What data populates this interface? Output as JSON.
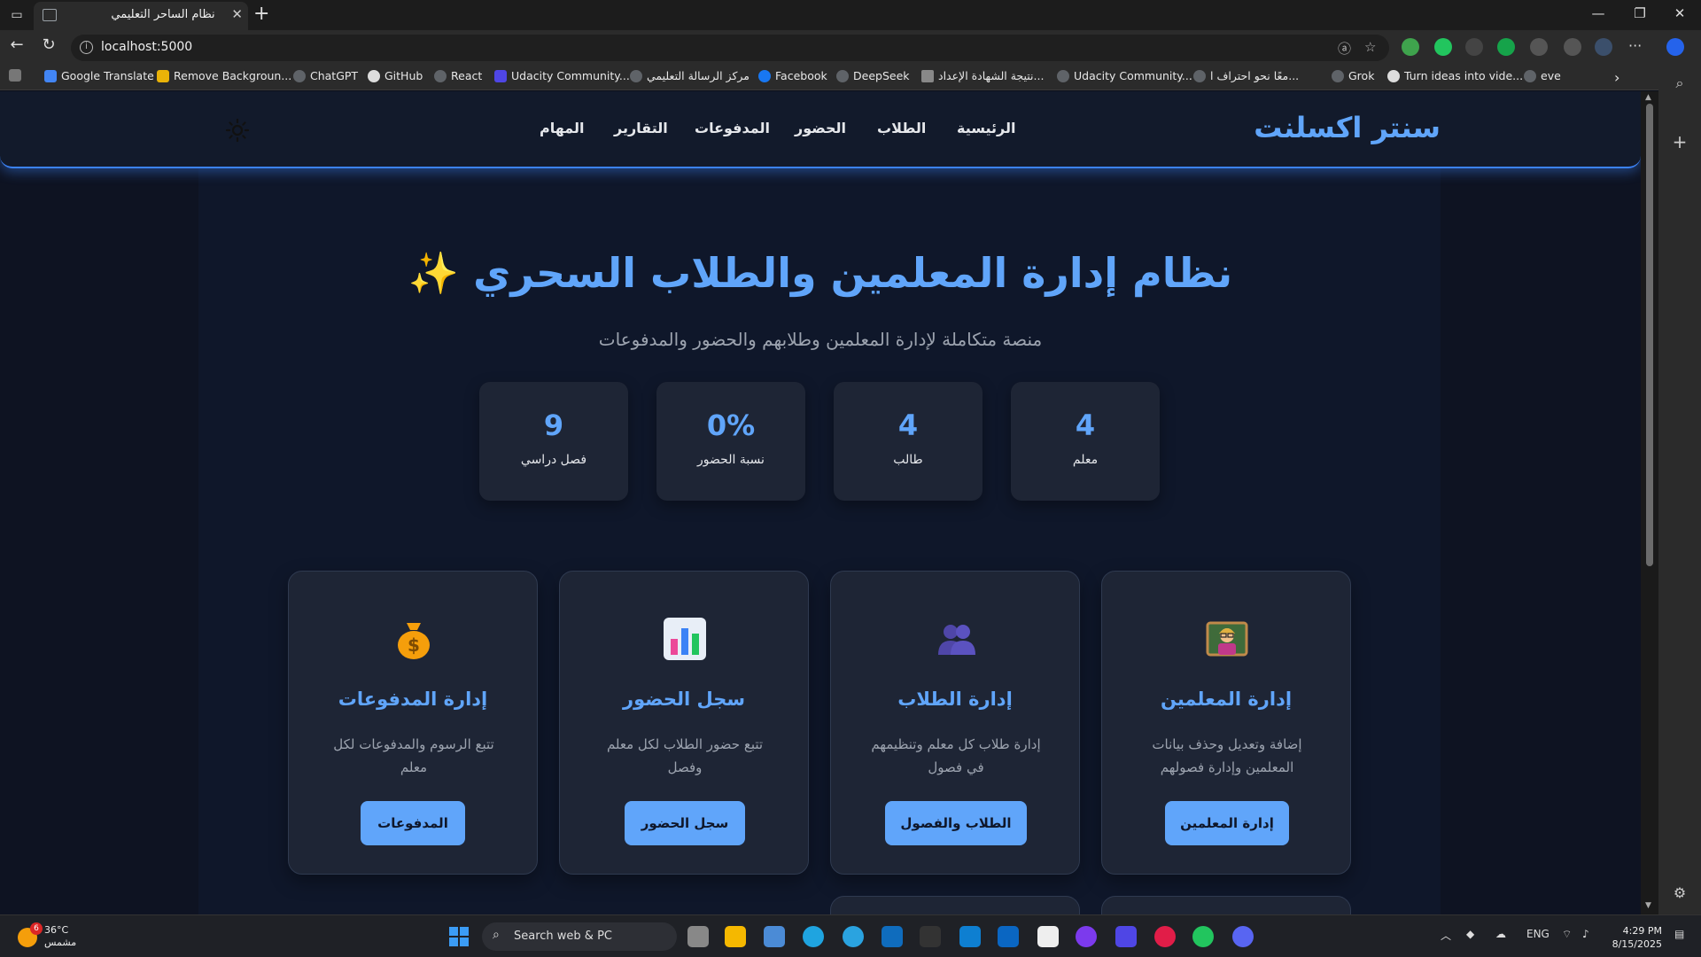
{
  "browser": {
    "tab_title": "نظام الساحر التعليمي",
    "url": "localhost:5000",
    "bookmarks": [
      "Google Translate",
      "Remove Backgroun...",
      "ChatGPT",
      "GitHub",
      "React",
      "Udacity Community...",
      "مركز الرسالة التعليمي",
      "Facebook",
      "DeepSeek",
      "نتيجة الشهادة الإعداد...",
      "Udacity Community...",
      "معًا نحو احتراف ا...",
      "Grok",
      "Turn ideas into vide...",
      "eve"
    ]
  },
  "app": {
    "brand": "سنتر اكسلنت",
    "nav": [
      "الرئيسية",
      "الطلاب",
      "الحضور",
      "المدفوعات",
      "التقارير",
      "المهام"
    ],
    "hero_title": "نظام إدارة المعلمين والطلاب السحري ✨",
    "hero_subtitle": "منصة متكاملة لإدارة المعلمين وطلابهم والحضور والمدفوعات",
    "stats": [
      {
        "value": "4",
        "label": "معلم"
      },
      {
        "value": "4",
        "label": "طالب"
      },
      {
        "value": "0%",
        "label": "نسبة الحضور"
      },
      {
        "value": "9",
        "label": "فصل دراسي"
      }
    ],
    "cards": [
      {
        "title": "إدارة المعلمين",
        "desc": "إضافة وتعديل وحذف بيانات المعلمين وإدارة فصولهم",
        "button": "إدارة المعلمين",
        "icon": "teacher-icon"
      },
      {
        "title": "إدارة الطلاب",
        "desc": "إدارة طلاب كل معلم وتنظيمهم في فصول",
        "button": "الطلاب والفصول",
        "icon": "students-icon"
      },
      {
        "title": "سجل الحضور",
        "desc": "تتبع حضور الطلاب لكل معلم وفصل",
        "button": "سجل الحضور",
        "icon": "bar-chart-icon"
      },
      {
        "title": "إدارة المدفوعات",
        "desc": "تتبع الرسوم والمدفوعات لكل معلم",
        "button": "المدفوعات",
        "icon": "money-bag-icon"
      }
    ]
  },
  "taskbar": {
    "temperature": "36°C",
    "weather": "مشمس",
    "weather_badge": "6",
    "search_placeholder": "Search web & PC",
    "lang": "ENG",
    "time": "4:29 PM",
    "date": "8/15/2025"
  }
}
